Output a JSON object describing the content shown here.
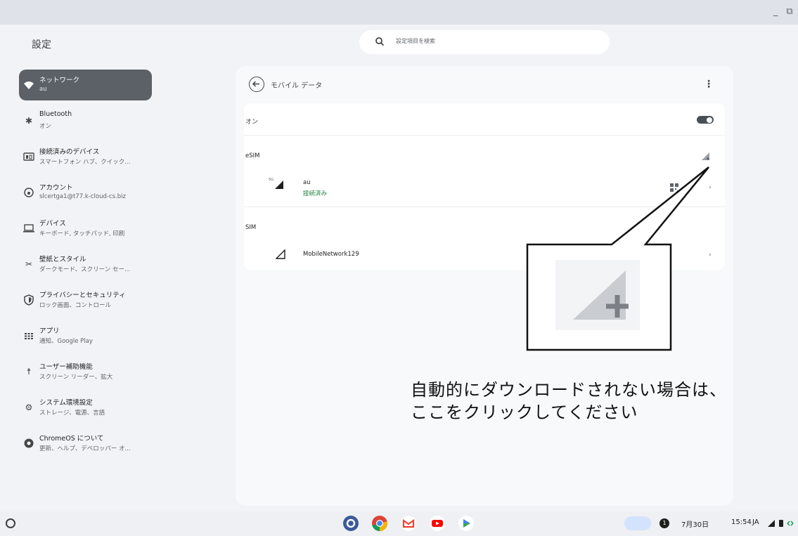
{
  "window": {
    "minimize_glyph": "_",
    "restore_glyph": "⧉"
  },
  "header": {
    "title": "設定",
    "search_placeholder": "設定項目を検索"
  },
  "sidebar": {
    "items": [
      {
        "title": "ネットワーク",
        "sub": "au",
        "icon": "wifi-icon",
        "active": true
      },
      {
        "title": "Bluetooth",
        "sub": "オン",
        "icon": "bluetooth-icon"
      },
      {
        "title": "接続済みのデバイス",
        "sub": "スマートフォン ハブ、クイック...",
        "icon": "connected-devices-icon"
      },
      {
        "title": "アカウント",
        "sub": "slcertga1@t77.k-cloud-cs.biz",
        "icon": "account-icon"
      },
      {
        "title": "デバイス",
        "sub": "キーボード, タッチパッド, 印刷",
        "icon": "laptop-icon"
      },
      {
        "title": "壁紙とスタイル",
        "sub": "ダークモード、スクリーン セー...",
        "icon": "palette-icon"
      },
      {
        "title": "プライバシーとセキュリティ",
        "sub": "ロック画面、コントロール",
        "icon": "shield-icon"
      },
      {
        "title": "アプリ",
        "sub": "通知、Google Play",
        "icon": "apps-grid-icon"
      },
      {
        "title": "ユーザー補助機能",
        "sub": "スクリーン リーダー、拡大",
        "icon": "accessibility-icon"
      },
      {
        "title": "システム環境設定",
        "sub": "ストレージ、電源、言語",
        "icon": "settings-gear-icon"
      },
      {
        "title": "ChromeOS について",
        "sub": "更新、ヘルプ、デベロッパー オ...",
        "icon": "chromeos-icon"
      }
    ]
  },
  "main": {
    "page_title": "モバイル データ",
    "mobile_toggle": {
      "label": "オン",
      "state": "on"
    },
    "esim": {
      "section_label": "eSIM",
      "network": {
        "badge": "5G",
        "name": "au",
        "status": "接続済み"
      }
    },
    "sim": {
      "section_label": "SIM",
      "network": {
        "name": "MobileNetwork129"
      }
    }
  },
  "annotation": {
    "line1": "自動的にダウンロードされない場合は、",
    "line2": "ここをクリックしてください"
  },
  "shelf": {
    "apps": [
      "settings-app-icon",
      "chrome-app-icon",
      "gmail-app-icon",
      "youtube-app-icon",
      "play-store-app-icon"
    ],
    "notification_count": "1",
    "date": "7月30日",
    "time": "15:54",
    "ime": "JA"
  },
  "colors": {
    "active_nav": "#5b6167",
    "connected_green": "#188038",
    "toggle_on": "#4a4f54"
  }
}
